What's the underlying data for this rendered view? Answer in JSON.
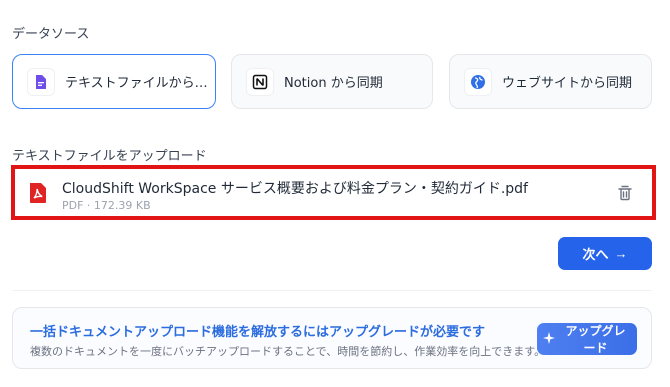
{
  "data_source": {
    "title": "データソース",
    "options": [
      {
        "label": "テキストファイルからイン...",
        "icon": "document-icon",
        "selected": true
      },
      {
        "label": "Notion から同期",
        "icon": "notion-icon",
        "selected": false
      },
      {
        "label": "ウェブサイトから同期",
        "icon": "globe-icon",
        "selected": false
      }
    ]
  },
  "upload": {
    "title": "テキストファイルをアップロード",
    "file": {
      "name": "CloudShift WorkSpace サービス概要および料金プラン・契約ガイド.pdf",
      "meta": "PDF · 172.39 KB",
      "icon": "pdf-icon"
    }
  },
  "next_button": {
    "label": "次へ",
    "arrow": "→"
  },
  "upgrade": {
    "title": "一括ドキュメントアップロード機能を解放するにはアップグレードが必要です",
    "description": "複数のドキュメントを一度にバッチアップロードすることで、時間を節約し、作業効率を向上できます。",
    "button_label": "アップグレード",
    "button_icon": "sparkle-icon"
  },
  "colors": {
    "accent": "#2563eb",
    "highlight_border": "#e11515",
    "upgrade_title": "#2b6cdf"
  }
}
